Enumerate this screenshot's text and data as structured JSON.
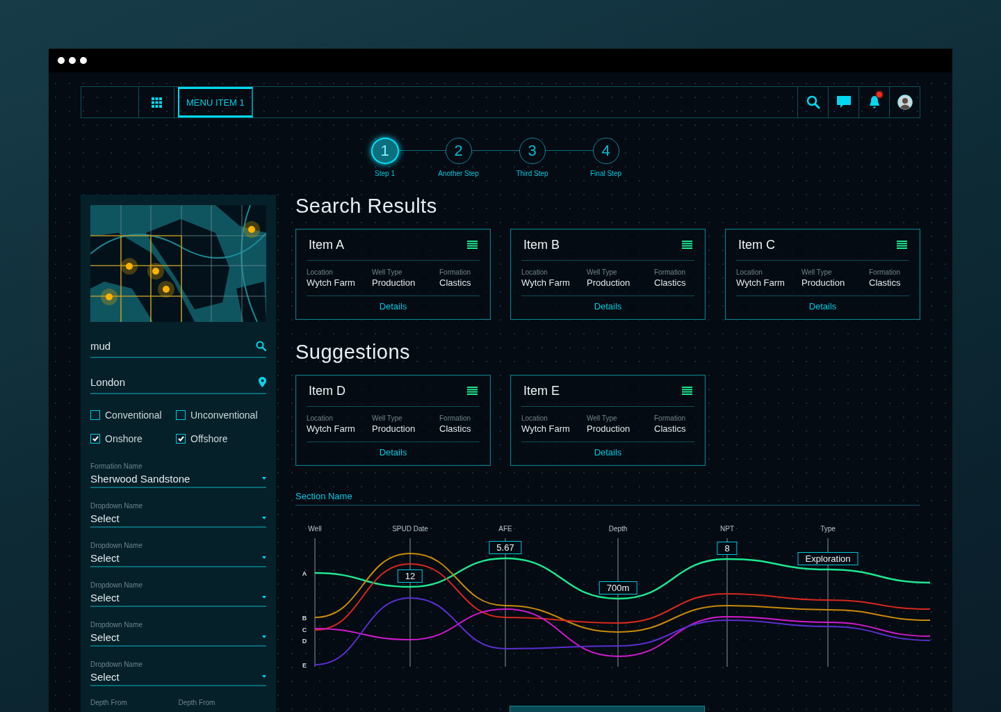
{
  "nav": {
    "menu_items": [
      {
        "label": "MENU ITEM 1",
        "selected": true
      }
    ],
    "notification_badge": true
  },
  "steps": [
    {
      "number": "1",
      "label": "Step 1",
      "selected": true
    },
    {
      "number": "2",
      "label": "Another Step",
      "selected": false
    },
    {
      "number": "3",
      "label": "Third Step",
      "selected": false
    },
    {
      "number": "4",
      "label": "Final Step",
      "selected": false
    }
  ],
  "sidebar": {
    "search": {
      "value": "mud"
    },
    "location": {
      "value": "London"
    },
    "checkboxes": [
      {
        "label": "Conventional",
        "checked": false
      },
      {
        "label": "Unconventional",
        "checked": false
      },
      {
        "label": "Onshore",
        "checked": true
      },
      {
        "label": "Offshore",
        "checked": true
      }
    ],
    "dropdowns": [
      {
        "label": "Formation Name",
        "value": "Sherwood Sandstone"
      },
      {
        "label": "Dropdown Name",
        "value": "Select"
      },
      {
        "label": "Dropdown Name",
        "value": "Select"
      },
      {
        "label": "Dropdown Name",
        "value": "Select"
      },
      {
        "label": "Dropdown Name",
        "value": "Select"
      },
      {
        "label": "Dropdown Name",
        "value": "Select"
      }
    ],
    "depth_labels": [
      "Depth From",
      "Depth From"
    ]
  },
  "search_results": {
    "title": "Search Results",
    "cards": [
      {
        "title": "Item A",
        "fields": [
          {
            "label": "Location",
            "value": "Wytch Farm"
          },
          {
            "label": "Well Type",
            "value": "Production"
          },
          {
            "label": "Formation",
            "value": "Clastics"
          }
        ],
        "link": "Details"
      },
      {
        "title": "Item B",
        "fields": [
          {
            "label": "Location",
            "value": "Wytch Farm"
          },
          {
            "label": "Well Type",
            "value": "Production"
          },
          {
            "label": "Formation",
            "value": "Clastics"
          }
        ],
        "link": "Details"
      },
      {
        "title": "Item C",
        "fields": [
          {
            "label": "Location",
            "value": "Wytch Farm"
          },
          {
            "label": "Well Type",
            "value": "Production"
          },
          {
            "label": "Formation",
            "value": "Clastics"
          }
        ],
        "link": "Details"
      }
    ]
  },
  "suggestions": {
    "title": "Suggestions",
    "cards": [
      {
        "title": "Item D",
        "fields": [
          {
            "label": "Location",
            "value": "Wytch Farm"
          },
          {
            "label": "Well Type",
            "value": "Production"
          },
          {
            "label": "Formation",
            "value": "Clastics"
          }
        ],
        "link": "Details"
      },
      {
        "title": "Item E",
        "fields": [
          {
            "label": "Location",
            "value": "Wytch Farm"
          },
          {
            "label": "Well Type",
            "value": "Production"
          },
          {
            "label": "Formation",
            "value": "Clastics"
          }
        ],
        "link": "Details"
      }
    ]
  },
  "section": {
    "title": "Section Name",
    "chart": {
      "axes": [
        "Well",
        "SPUD Date",
        "AFE",
        "Depth",
        "NPT",
        "Type"
      ],
      "rows": [
        "A",
        "B",
        "C",
        "D",
        "E"
      ],
      "callouts": [
        {
          "text": "12"
        },
        {
          "text": "5.67"
        },
        {
          "text": "700m"
        },
        {
          "text": "8"
        },
        {
          "text": "Exploration"
        }
      ],
      "lines": [
        {
          "color": "#1de88f"
        },
        {
          "color": "#c98a0a"
        },
        {
          "color": "#d8281e"
        },
        {
          "color": "#d21ad0"
        },
        {
          "color": "#5a2fd0"
        }
      ]
    }
  }
}
